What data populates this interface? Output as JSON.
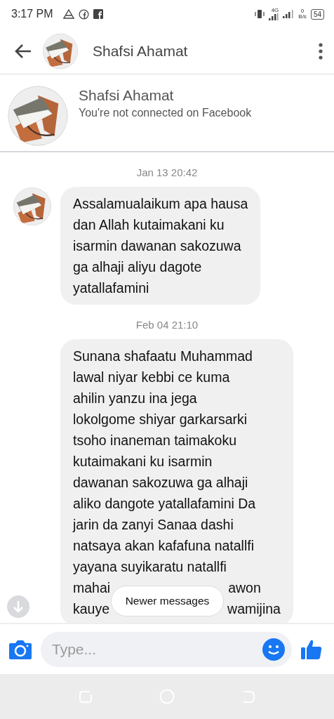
{
  "status_bar": {
    "time": "3:17 PM",
    "network_label": "4G",
    "speed_value": "0",
    "speed_unit": "B/s",
    "battery": "54"
  },
  "header": {
    "title": "Shafsi Ahamat"
  },
  "profile": {
    "name": "Shafsi Ahamat",
    "subtitle": "You're not connected on Facebook"
  },
  "messages": [
    {
      "timestamp": "Jan 13 20:42",
      "show_avatar": true,
      "lines": [
        [
          "Assalamualaikum apa hausa"
        ],
        [
          "dan Allah kutaimakani ku"
        ],
        [
          "isarmin dawanan sakozuwa"
        ],
        [
          "ga alhaji aliyu dagote"
        ],
        [
          "yatallafamini"
        ]
      ]
    },
    {
      "timestamp": "Feb 04 21:10",
      "show_avatar": false,
      "lines": [
        [
          "Sunana shafaatu Muhammad"
        ],
        [
          "lawal niyar kebbi ce kuma"
        ],
        [
          "ahilin yanzu ina jega"
        ],
        [
          "lokolgome shiyar garkarsarki"
        ],
        [
          "tsoho inaneman taimakoku"
        ],
        [
          "kutaimakani ku isarmin"
        ],
        [
          "dawanan sakozuwa ga alhaji"
        ],
        [
          "aliko dangote yatallafamini Da"
        ],
        [
          "jarin da zanyi Sanaa dashi"
        ],
        [
          "natsaya akan kafafuna natallfi"
        ],
        [
          "yayana suyikaratu natallfi"
        ],
        [
          "mahai",
          "awon"
        ],
        [
          "kauye",
          "wamijina"
        ]
      ]
    }
  ],
  "newer_messages": "Newer messages",
  "composer": {
    "placeholder": "Type..."
  }
}
